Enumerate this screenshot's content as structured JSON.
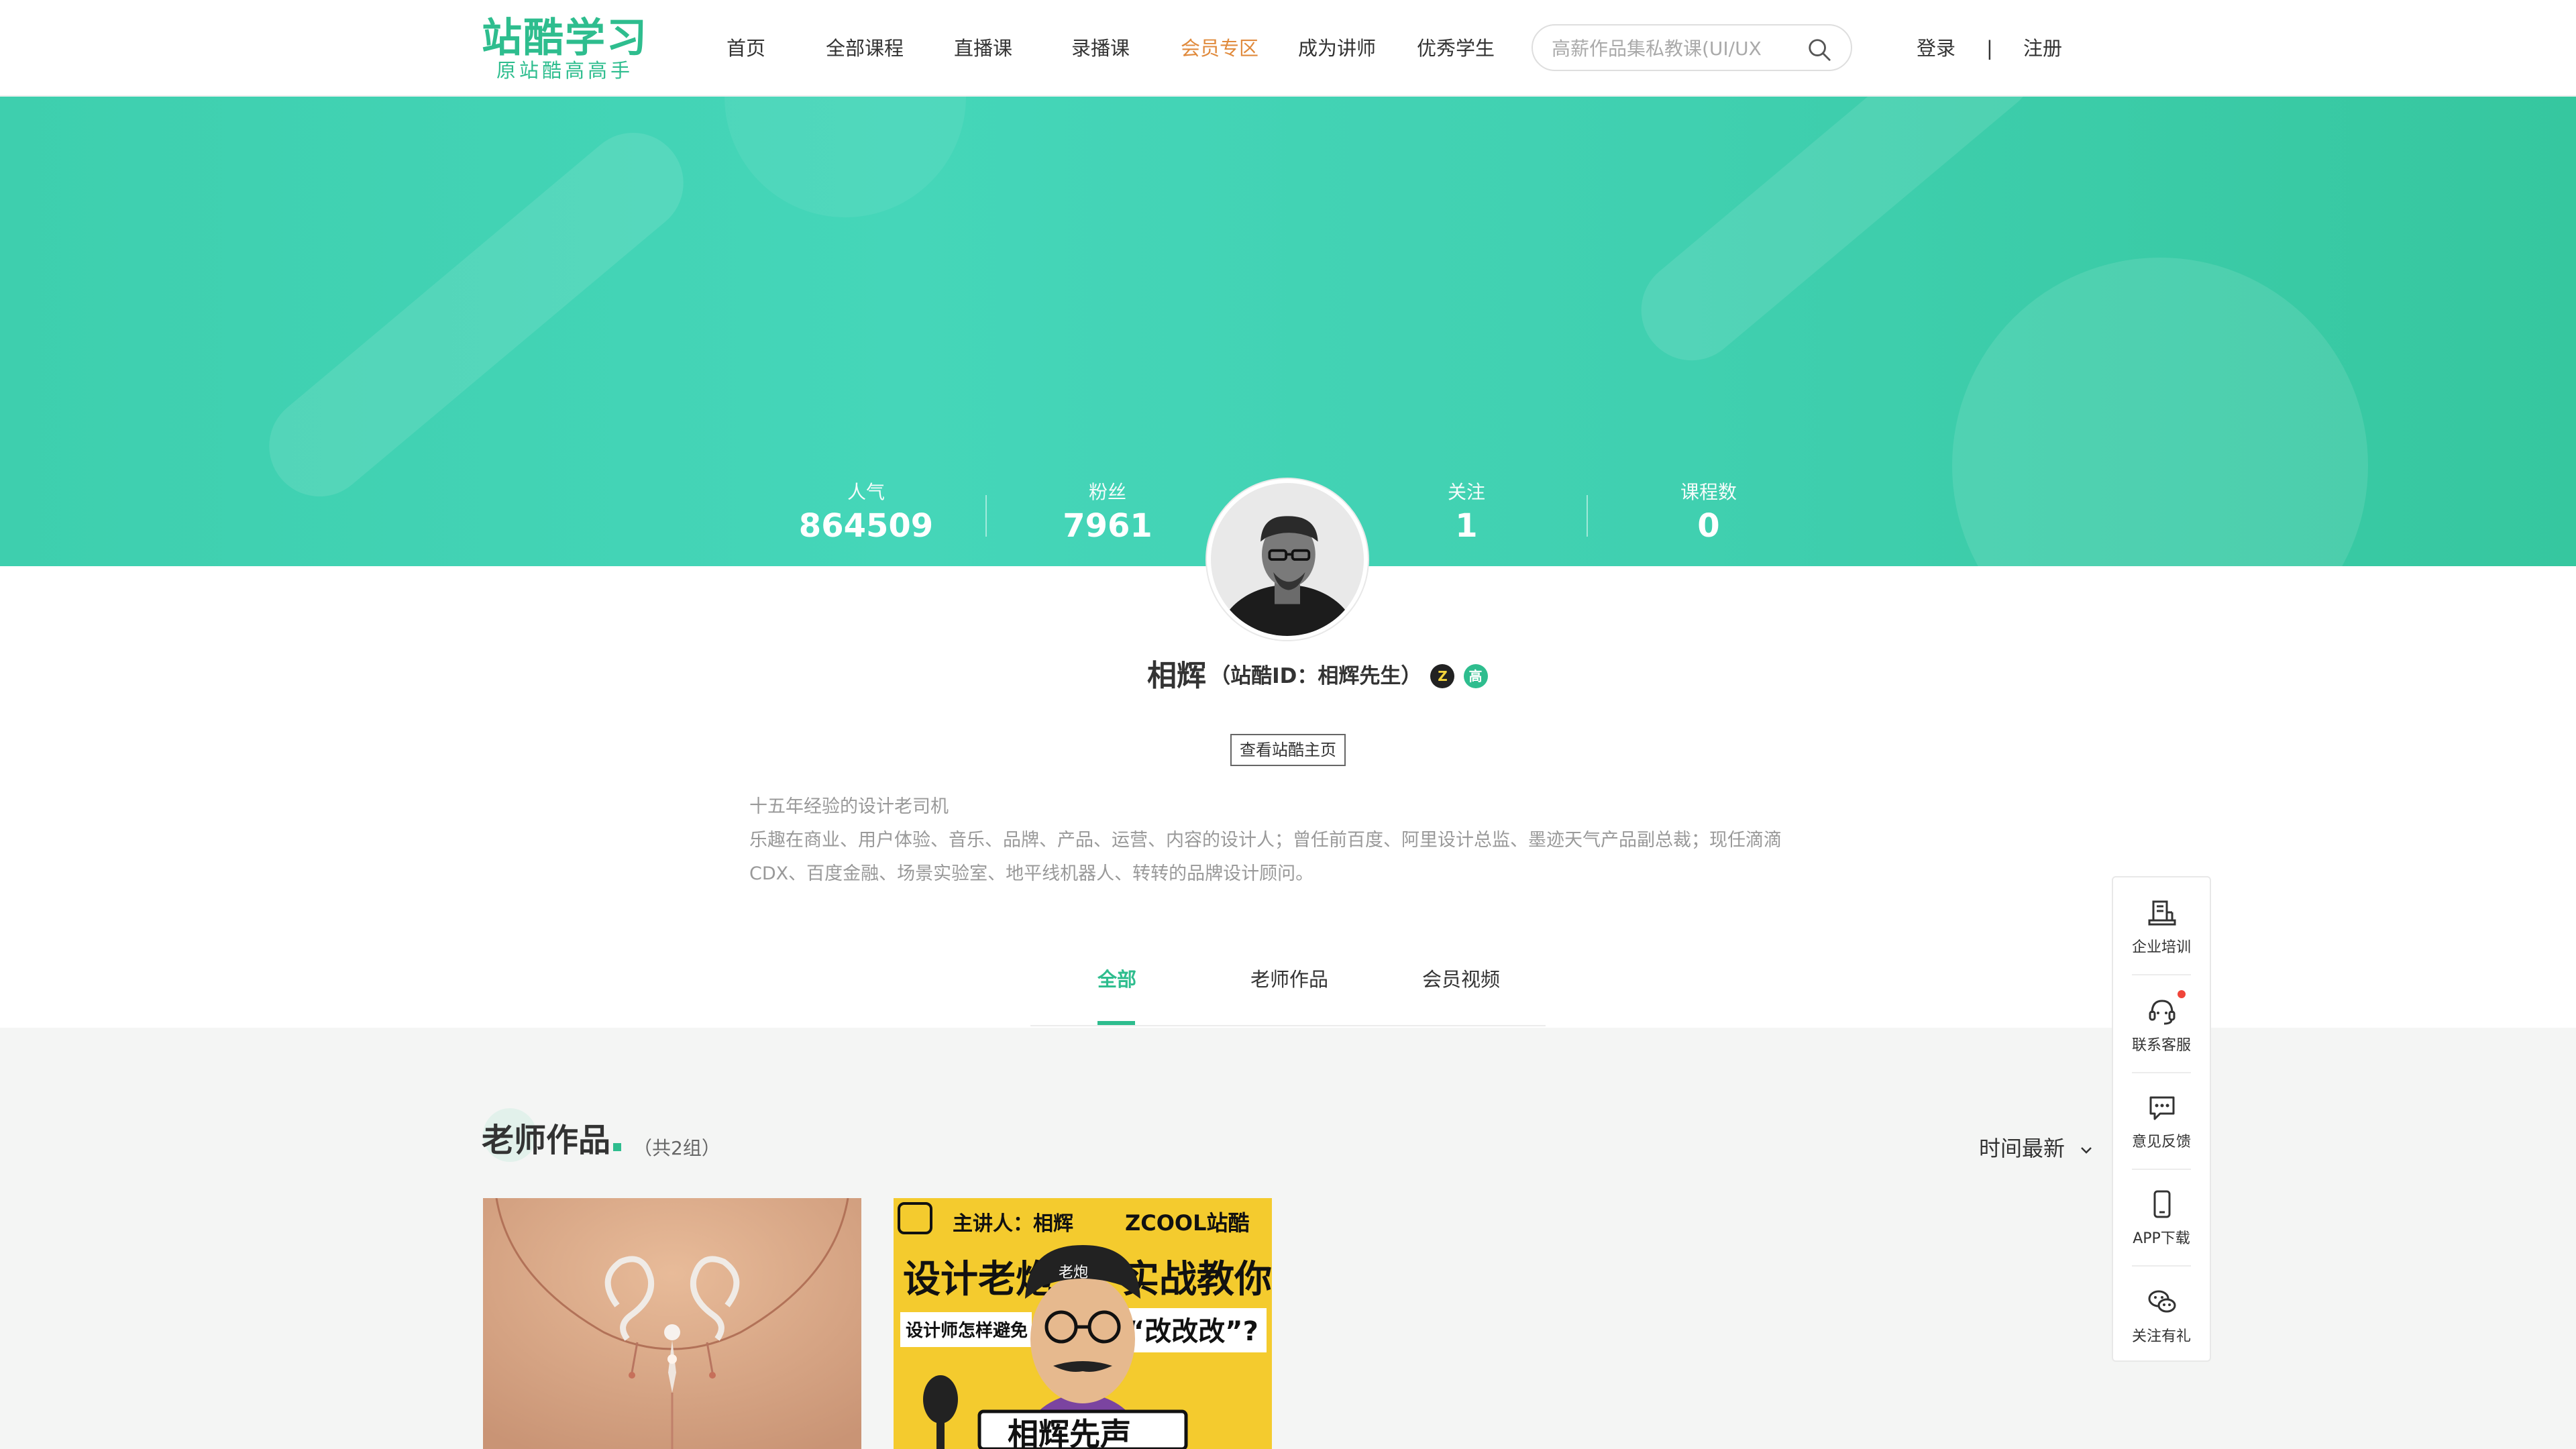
{
  "header": {
    "logo_main": "站酷学习",
    "logo_sub": "原站酷高高手",
    "nav": [
      {
        "label": "首页"
      },
      {
        "label": "全部课程"
      },
      {
        "label": "直播课"
      },
      {
        "label": "录播课"
      },
      {
        "label": "会员专区"
      },
      {
        "label": "成为讲师"
      },
      {
        "label": "优秀学生"
      }
    ],
    "search_placeholder": "高薪作品集私教课(UI/UX",
    "login": "登录",
    "separator": "|",
    "register": "注册"
  },
  "stats": [
    {
      "label": "人气",
      "value": "864509"
    },
    {
      "label": "粉丝",
      "value": "7961"
    },
    {
      "label": "关注",
      "value": "1"
    },
    {
      "label": "课程数",
      "value": "0"
    }
  ],
  "profile": {
    "name": "相辉",
    "zcool_id": "（站酷ID：相辉先生）",
    "badge_z": "Z",
    "badge_g": "高",
    "view_home": "查看站酷主页",
    "bio_line1": "十五年经验的设计老司机",
    "bio_line2": "乐趣在商业、用户体验、音乐、品牌、产品、运营、内容的设计人；曾任前百度、阿里设计总监、墨迹天气产品副总裁；现任滴滴CDX、百度金融、场景实验室、地平线机器人、转转的品牌设计顾问。"
  },
  "tabs": [
    {
      "label": "全部"
    },
    {
      "label": "老师作品"
    },
    {
      "label": "会员视频"
    }
  ],
  "works": {
    "title": "老师作品",
    "count": "（共2组）",
    "sort_label": "时间最新",
    "card2": {
      "speaker": "主讲人：相辉",
      "brand": "ZCOOL站酷",
      "headline_left": "设计老炮",
      "headline_right": "实战教你",
      "sub_left": "设计师怎样避免",
      "sub_right": "“改改改”?",
      "hat_text": "老炮",
      "sign_text": "相辉先声"
    }
  },
  "sidebar": [
    {
      "label": "企业培训"
    },
    {
      "label": "联系客服"
    },
    {
      "label": "意见反馈"
    },
    {
      "label": "APP下载"
    },
    {
      "label": "关注有礼"
    }
  ]
}
